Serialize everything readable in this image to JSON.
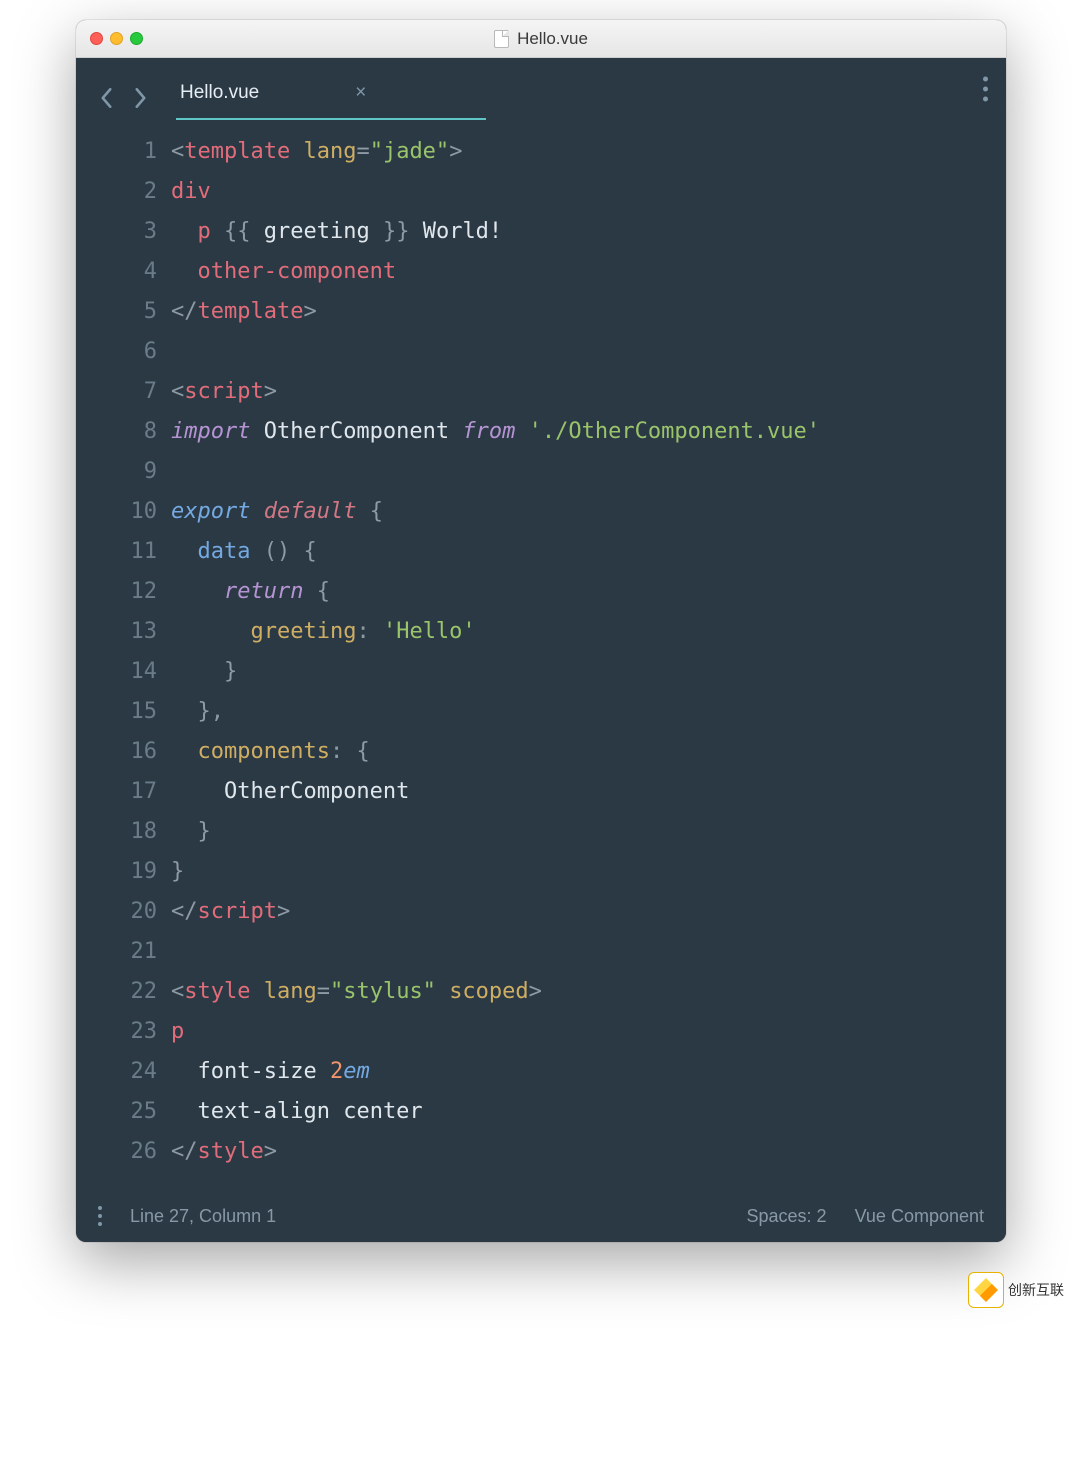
{
  "window": {
    "title": "Hello.vue"
  },
  "tabs": {
    "title": "Hello.vue"
  },
  "gutter": {
    "lines": [
      "1",
      "2",
      "3",
      "4",
      "5",
      "6",
      "7",
      "8",
      "9",
      "10",
      "11",
      "12",
      "13",
      "14",
      "15",
      "16",
      "17",
      "18",
      "19",
      "20",
      "21",
      "22",
      "23",
      "24",
      "25",
      "26"
    ]
  },
  "code": {
    "lines": [
      [
        {
          "t": "<",
          "c": "c-punc"
        },
        {
          "t": "template ",
          "c": "c-tag"
        },
        {
          "t": "lang",
          "c": "c-attr"
        },
        {
          "t": "=",
          "c": "c-punc"
        },
        {
          "t": "\"jade\"",
          "c": "c-str"
        },
        {
          "t": ">",
          "c": "c-punc"
        }
      ],
      [
        {
          "t": "div",
          "c": "c-tag"
        }
      ],
      [
        {
          "t": "  ",
          "c": ""
        },
        {
          "t": "p ",
          "c": "c-tag"
        },
        {
          "t": "{{ ",
          "c": "c-punc"
        },
        {
          "t": "greeting",
          "c": "c-ent"
        },
        {
          "t": " }} ",
          "c": "c-punc"
        },
        {
          "t": "World!",
          "c": "c-ent"
        }
      ],
      [
        {
          "t": "  ",
          "c": ""
        },
        {
          "t": "other-component",
          "c": "c-tag"
        }
      ],
      [
        {
          "t": "</",
          "c": "c-punc"
        },
        {
          "t": "template",
          "c": "c-tag"
        },
        {
          "t": ">",
          "c": "c-punc"
        }
      ],
      [
        {
          "t": " ",
          "c": ""
        }
      ],
      [
        {
          "t": "<",
          "c": "c-punc"
        },
        {
          "t": "script",
          "c": "c-tag"
        },
        {
          "t": ">",
          "c": "c-punc"
        }
      ],
      [
        {
          "t": "import ",
          "c": "c-kw2"
        },
        {
          "t": "OtherComponent ",
          "c": "c-ent"
        },
        {
          "t": "from ",
          "c": "c-kw2"
        },
        {
          "t": "'./OtherComponent.vue'",
          "c": "c-str"
        }
      ],
      [
        {
          "t": " ",
          "c": ""
        }
      ],
      [
        {
          "t": "export ",
          "c": "c-kw"
        },
        {
          "t": "default ",
          "c": "c-kwred"
        },
        {
          "t": "{",
          "c": "c-punc"
        }
      ],
      [
        {
          "t": "  ",
          "c": ""
        },
        {
          "t": "data ",
          "c": "c-blue"
        },
        {
          "t": "() {",
          "c": "c-punc"
        }
      ],
      [
        {
          "t": "    ",
          "c": ""
        },
        {
          "t": "return ",
          "c": "c-kw2"
        },
        {
          "t": "{",
          "c": "c-punc"
        }
      ],
      [
        {
          "t": "      ",
          "c": ""
        },
        {
          "t": "greeting",
          "c": "c-prop"
        },
        {
          "t": ": ",
          "c": "c-punc"
        },
        {
          "t": "'Hello'",
          "c": "c-str"
        }
      ],
      [
        {
          "t": "    }",
          "c": "c-punc"
        }
      ],
      [
        {
          "t": "  },",
          "c": "c-punc"
        }
      ],
      [
        {
          "t": "  ",
          "c": ""
        },
        {
          "t": "components",
          "c": "c-prop"
        },
        {
          "t": ": {",
          "c": "c-punc"
        }
      ],
      [
        {
          "t": "    ",
          "c": ""
        },
        {
          "t": "OtherComponent",
          "c": "c-ent"
        }
      ],
      [
        {
          "t": "  }",
          "c": "c-punc"
        }
      ],
      [
        {
          "t": "}",
          "c": "c-punc"
        }
      ],
      [
        {
          "t": "</",
          "c": "c-punc"
        },
        {
          "t": "script",
          "c": "c-tag"
        },
        {
          "t": ">",
          "c": "c-punc"
        }
      ],
      [
        {
          "t": " ",
          "c": ""
        }
      ],
      [
        {
          "t": "<",
          "c": "c-punc"
        },
        {
          "t": "style ",
          "c": "c-tag"
        },
        {
          "t": "lang",
          "c": "c-attr"
        },
        {
          "t": "=",
          "c": "c-punc"
        },
        {
          "t": "\"stylus\" ",
          "c": "c-str"
        },
        {
          "t": "scoped",
          "c": "c-attr"
        },
        {
          "t": ">",
          "c": "c-punc"
        }
      ],
      [
        {
          "t": "p",
          "c": "c-tag"
        }
      ],
      [
        {
          "t": "  ",
          "c": ""
        },
        {
          "t": "font-size ",
          "c": "c-ent"
        },
        {
          "t": "2",
          "c": "c-orange"
        },
        {
          "t": "em",
          "c": "c-unit"
        }
      ],
      [
        {
          "t": "  ",
          "c": ""
        },
        {
          "t": "text-align ",
          "c": "c-ent"
        },
        {
          "t": "center",
          "c": "c-ent"
        }
      ],
      [
        {
          "t": "</",
          "c": "c-punc"
        },
        {
          "t": "style",
          "c": "c-tag"
        },
        {
          "t": ">",
          "c": "c-punc"
        }
      ]
    ]
  },
  "status": {
    "cursor": "Line 27, Column 1",
    "indent": "Spaces: 2",
    "syntax": "Vue Component"
  },
  "watermark": "创新互联"
}
